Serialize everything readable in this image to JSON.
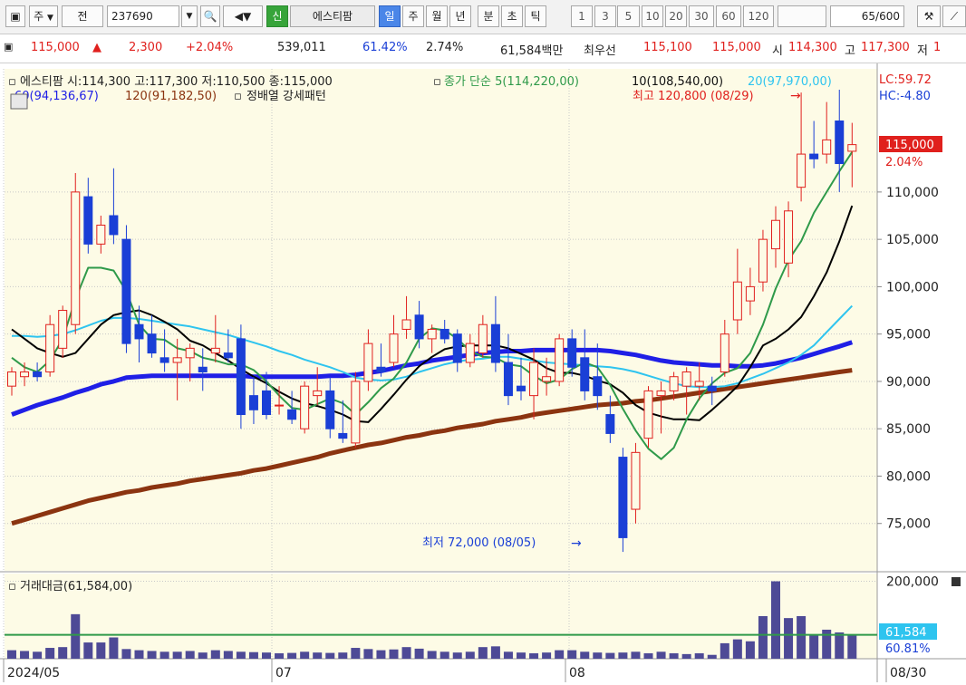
{
  "toolbar": {
    "period_dropdown": "주",
    "prev_label": "전",
    "stock_code": "237690",
    "new_badge": "신",
    "stock_name": "에스티팜",
    "period_tabs": [
      "일",
      "주",
      "월",
      "년",
      "분",
      "초",
      "틱"
    ],
    "interval_buttons": [
      "1",
      "3",
      "5",
      "10",
      "20",
      "30",
      "60",
      "120"
    ],
    "count": "65",
    "count_total": "/600"
  },
  "quote": {
    "price": "115,000",
    "change": "2,300",
    "change_pct": "+2.04%",
    "volume": "539,011",
    "ratio1": "61.42%",
    "ratio2": "2.74%",
    "amount": "61,584백만",
    "best_ask_label": "최우선",
    "best_ask": "115,100",
    "best_bid": "115,000",
    "open_label": "시",
    "open": "114,300",
    "high_label": "고",
    "high": "117,300",
    "low_label": "저",
    "low": "1"
  },
  "legend": {
    "main": "에스티팜 시:114,300 고:117,300 저:110,500 종:115,000",
    "ma_label": "종가 단순 5(114,220,00)",
    "ma10": "10(108,540,00)",
    "ma20": "20(97,970,00)",
    "ma60": "60(94,136,67)",
    "ma120": "120(91,182,50)",
    "pattern": "정배열 강세패턴",
    "lc": "LC:59.72",
    "hc": "HC:-4.80",
    "high_note": "최고 120,800 (08/29)",
    "low_note": "최저 72,000 (08/05)",
    "volume_title": "거래대금(61,584,00)"
  },
  "right_axis": {
    "price_badge": "115,000",
    "price_pct": "2.04%",
    "vol_badge": "61,584",
    "vol_pct": "60.81%"
  },
  "x_axis": {
    "labels": [
      "2024/05",
      "07",
      "08",
      "08/30"
    ]
  },
  "colors": {
    "up": "#e0201d",
    "down": "#1a3fd6",
    "ma5": "#2f9a4a",
    "ma10": "#000000",
    "ma20": "#2ec4ef",
    "ma60": "#1f1fe6",
    "ma120": "#8b3410",
    "volume": "#4e4a96",
    "chart_bg": "#fdfbe6"
  },
  "chart_data": {
    "type": "candlestick",
    "ylim": [
      70000,
      123000
    ],
    "yticks": [
      "110,000",
      "105,000",
      "100,000",
      "95,000",
      "90,000",
      "85,000",
      "80,000",
      "75,000"
    ],
    "ytick_values": [
      110000,
      105000,
      100000,
      95000,
      90000,
      85000,
      80000,
      75000
    ],
    "vol_ylim": [
      0,
      220000
    ],
    "vol_yticks": [
      "200,000"
    ],
    "vol_ytick_values": [
      200000
    ],
    "vol_average": 61584,
    "candles": [
      {
        "o": 89500,
        "h": 91500,
        "l": 88500,
        "c": 91000,
        "v": 22000
      },
      {
        "o": 90500,
        "h": 92000,
        "l": 89500,
        "c": 91000,
        "v": 20000
      },
      {
        "o": 91000,
        "h": 92000,
        "l": 90000,
        "c": 90500,
        "v": 18000
      },
      {
        "o": 91000,
        "h": 97000,
        "l": 90500,
        "c": 96000,
        "v": 28000
      },
      {
        "o": 93500,
        "h": 98000,
        "l": 92500,
        "c": 97500,
        "v": 30000
      },
      {
        "o": 96000,
        "h": 112000,
        "l": 95000,
        "c": 110000,
        "v": 115000
      },
      {
        "o": 109500,
        "h": 111500,
        "l": 103500,
        "c": 104500,
        "v": 42000
      },
      {
        "o": 104500,
        "h": 107500,
        "l": 103500,
        "c": 106500,
        "v": 42000
      },
      {
        "o": 107500,
        "h": 112500,
        "l": 104500,
        "c": 105500,
        "v": 55000
      },
      {
        "o": 105000,
        "h": 106500,
        "l": 93000,
        "c": 94000,
        "v": 25000
      },
      {
        "o": 96000,
        "h": 98000,
        "l": 92000,
        "c": 94500,
        "v": 22000
      },
      {
        "o": 95000,
        "h": 97000,
        "l": 92500,
        "c": 93000,
        "v": 20000
      },
      {
        "o": 92500,
        "h": 95500,
        "l": 91000,
        "c": 92000,
        "v": 18000
      },
      {
        "o": 92000,
        "h": 94500,
        "l": 88000,
        "c": 92500,
        "v": 18000
      },
      {
        "o": 92500,
        "h": 94000,
        "l": 90000,
        "c": 93500,
        "v": 20000
      },
      {
        "o": 91500,
        "h": 93500,
        "l": 89000,
        "c": 91000,
        "v": 16000
      },
      {
        "o": 93000,
        "h": 97000,
        "l": 92000,
        "c": 93500,
        "v": 22000
      },
      {
        "o": 93000,
        "h": 95500,
        "l": 92000,
        "c": 92500,
        "v": 20000
      },
      {
        "o": 94500,
        "h": 96000,
        "l": 85000,
        "c": 86500,
        "v": 18000
      },
      {
        "o": 88500,
        "h": 90500,
        "l": 85500,
        "c": 87000,
        "v": 17000
      },
      {
        "o": 89000,
        "h": 91000,
        "l": 86000,
        "c": 86500,
        "v": 16000
      },
      {
        "o": 87500,
        "h": 89500,
        "l": 86500,
        "c": 87500,
        "v": 14000
      },
      {
        "o": 87000,
        "h": 89000,
        "l": 85500,
        "c": 86000,
        "v": 15000
      },
      {
        "o": 85000,
        "h": 90000,
        "l": 84500,
        "c": 89500,
        "v": 18000
      },
      {
        "o": 88500,
        "h": 91500,
        "l": 87500,
        "c": 89000,
        "v": 16000
      },
      {
        "o": 89000,
        "h": 90500,
        "l": 84000,
        "c": 85000,
        "v": 15000
      },
      {
        "o": 84500,
        "h": 88000,
        "l": 83500,
        "c": 84000,
        "v": 16000
      },
      {
        "o": 83500,
        "h": 91000,
        "l": 83000,
        "c": 90000,
        "v": 28000
      },
      {
        "o": 90000,
        "h": 95500,
        "l": 89000,
        "c": 94000,
        "v": 25000
      },
      {
        "o": 91500,
        "h": 94000,
        "l": 90500,
        "c": 91000,
        "v": 22000
      },
      {
        "o": 92000,
        "h": 97000,
        "l": 91500,
        "c": 95000,
        "v": 24000
      },
      {
        "o": 95500,
        "h": 99000,
        "l": 94500,
        "c": 96500,
        "v": 30000
      },
      {
        "o": 97000,
        "h": 98500,
        "l": 93500,
        "c": 94500,
        "v": 26000
      },
      {
        "o": 94500,
        "h": 96000,
        "l": 93000,
        "c": 95500,
        "v": 20000
      },
      {
        "o": 95500,
        "h": 96500,
        "l": 94000,
        "c": 94500,
        "v": 18000
      },
      {
        "o": 95000,
        "h": 95500,
        "l": 91000,
        "c": 92000,
        "v": 16000
      },
      {
        "o": 92000,
        "h": 95000,
        "l": 91500,
        "c": 94000,
        "v": 18000
      },
      {
        "o": 93000,
        "h": 97000,
        "l": 92500,
        "c": 96000,
        "v": 30000
      },
      {
        "o": 96000,
        "h": 99000,
        "l": 91000,
        "c": 92000,
        "v": 32000
      },
      {
        "o": 92000,
        "h": 95000,
        "l": 87500,
        "c": 88500,
        "v": 18000
      },
      {
        "o": 89500,
        "h": 92500,
        "l": 88000,
        "c": 89000,
        "v": 16000
      },
      {
        "o": 88500,
        "h": 93500,
        "l": 86000,
        "c": 92000,
        "v": 14000
      },
      {
        "o": 90000,
        "h": 92500,
        "l": 88500,
        "c": 90500,
        "v": 16000
      },
      {
        "o": 90000,
        "h": 95000,
        "l": 89500,
        "c": 94500,
        "v": 22000
      },
      {
        "o": 94500,
        "h": 95500,
        "l": 90500,
        "c": 91500,
        "v": 22000
      },
      {
        "o": 92500,
        "h": 95500,
        "l": 88000,
        "c": 89000,
        "v": 18000
      },
      {
        "o": 90500,
        "h": 94000,
        "l": 87000,
        "c": 88500,
        "v": 16000
      },
      {
        "o": 86500,
        "h": 88500,
        "l": 83500,
        "c": 84500,
        "v": 15000
      },
      {
        "o": 82000,
        "h": 83000,
        "l": 72000,
        "c": 73500,
        "v": 16000
      },
      {
        "o": 76500,
        "h": 83500,
        "l": 75000,
        "c": 82500,
        "v": 18000
      },
      {
        "o": 84000,
        "h": 89500,
        "l": 83000,
        "c": 89000,
        "v": 14000
      },
      {
        "o": 88500,
        "h": 90000,
        "l": 84500,
        "c": 89000,
        "v": 18000
      },
      {
        "o": 89000,
        "h": 91000,
        "l": 88000,
        "c": 90500,
        "v": 14000
      },
      {
        "o": 89500,
        "h": 91500,
        "l": 86500,
        "c": 91000,
        "v": 12000
      },
      {
        "o": 89500,
        "h": 92000,
        "l": 88000,
        "c": 90000,
        "v": 14000
      },
      {
        "o": 89500,
        "h": 90500,
        "l": 87500,
        "c": 89000,
        "v": 10000
      },
      {
        "o": 91000,
        "h": 96500,
        "l": 90500,
        "c": 95000,
        "v": 40000
      },
      {
        "o": 96500,
        "h": 104000,
        "l": 95000,
        "c": 100500,
        "v": 50000
      },
      {
        "o": 98500,
        "h": 102000,
        "l": 97000,
        "c": 100000,
        "v": 45000
      },
      {
        "o": 100500,
        "h": 106000,
        "l": 99500,
        "c": 105000,
        "v": 110000
      },
      {
        "o": 104000,
        "h": 108500,
        "l": 102000,
        "c": 107000,
        "v": 200000
      },
      {
        "o": 102500,
        "h": 109000,
        "l": 101000,
        "c": 108000,
        "v": 105000
      },
      {
        "o": 110500,
        "h": 120500,
        "l": 109000,
        "c": 114000,
        "v": 110000
      },
      {
        "o": 114000,
        "h": 117500,
        "l": 112500,
        "c": 113500,
        "v": 60000
      },
      {
        "o": 114000,
        "h": 119500,
        "l": 113000,
        "c": 115500,
        "v": 75000
      },
      {
        "o": 117500,
        "h": 120800,
        "l": 110000,
        "c": 113000,
        "v": 68000
      },
      {
        "o": 114300,
        "h": 117300,
        "l": 110500,
        "c": 115000,
        "v": 61584
      }
    ],
    "ma5": [
      92500,
      91500,
      91000,
      92200,
      94500,
      98700,
      102000,
      102000,
      101700,
      99500,
      96000,
      94500,
      94400,
      93500,
      93200,
      92500,
      92200,
      91800,
      91800,
      91200,
      90000,
      88500,
      87200,
      87000,
      87600,
      88200,
      87700,
      86500,
      87800,
      89300,
      90300,
      92000,
      94500,
      95600,
      95400,
      94500,
      93200,
      92600,
      92500,
      91800,
      91600,
      90600,
      89800,
      90200,
      91300,
      92000,
      91500,
      89600,
      87100,
      84800,
      82900,
      81800,
      83000,
      86000,
      88200,
      89800,
      90900,
      91400,
      93000,
      96000,
      99800,
      102800,
      104800,
      107800,
      110000,
      112200,
      114220
    ],
    "ma10": [
      95500,
      94500,
      93500,
      93000,
      92600,
      93000,
      94500,
      96000,
      97000,
      97300,
      97500,
      97000,
      96300,
      95500,
      94300,
      93800,
      93000,
      92200,
      91300,
      90500,
      89800,
      88900,
      88200,
      87700,
      87400,
      87000,
      86500,
      85800,
      85700,
      87100,
      88600,
      90200,
      91600,
      92600,
      93400,
      93700,
      93800,
      93800,
      93800,
      93500,
      92900,
      92300,
      91400,
      90900,
      90900,
      90600,
      90100,
      89700,
      88800,
      87500,
      86700,
      86300,
      86000,
      86000,
      85900,
      87000,
      88200,
      89500,
      91500,
      93800,
      94500,
      95500,
      96800,
      99000,
      101500,
      104800,
      108540
    ],
    "ma20": [
      94800,
      94800,
      94700,
      94800,
      95000,
      95400,
      95900,
      96400,
      96700,
      96700,
      96600,
      96400,
      96200,
      96000,
      95800,
      95500,
      95200,
      94900,
      94500,
      94100,
      93700,
      93200,
      92800,
      92300,
      91900,
      91500,
      91000,
      90400,
      90200,
      90100,
      90200,
      90500,
      91000,
      91400,
      91800,
      92100,
      92300,
      92400,
      92600,
      92600,
      92400,
      92200,
      92000,
      91900,
      91800,
      91700,
      91600,
      91500,
      91300,
      91000,
      90600,
      90200,
      89800,
      89500,
      89400,
      89400,
      89500,
      89800,
      90300,
      90800,
      91400,
      92000,
      92800,
      93800,
      95200,
      96600,
      97970
    ],
    "ma60": [
      86500,
      87000,
      87500,
      87900,
      88300,
      88800,
      89200,
      89700,
      90000,
      90400,
      90500,
      90600,
      90600,
      90600,
      90600,
      90600,
      90600,
      90600,
      90600,
      90500,
      90500,
      90500,
      90500,
      90500,
      90500,
      90600,
      90600,
      90700,
      90900,
      91100,
      91400,
      91700,
      91900,
      92200,
      92400,
      92600,
      92800,
      93000,
      93100,
      93200,
      93200,
      93300,
      93300,
      93300,
      93300,
      93300,
      93300,
      93200,
      93000,
      92800,
      92500,
      92200,
      92000,
      91900,
      91800,
      91700,
      91700,
      91600,
      91600,
      91700,
      91900,
      92200,
      92500,
      92900,
      93300,
      93700,
      94136
    ],
    "ma120": [
      75000,
      75400,
      75800,
      76200,
      76600,
      77000,
      77400,
      77700,
      78000,
      78300,
      78500,
      78800,
      79000,
      79200,
      79500,
      79700,
      79900,
      80100,
      80300,
      80600,
      80800,
      81100,
      81400,
      81700,
      82000,
      82400,
      82700,
      83000,
      83300,
      83500,
      83800,
      84100,
      84300,
      84600,
      84800,
      85100,
      85300,
      85500,
      85800,
      86000,
      86200,
      86500,
      86700,
      86900,
      87100,
      87300,
      87500,
      87600,
      87700,
      87900,
      88000,
      88200,
      88400,
      88600,
      88800,
      89000,
      89200,
      89400,
      89600,
      89800,
      90000,
      90200,
      90400,
      90600,
      90800,
      91000,
      91182
    ]
  }
}
